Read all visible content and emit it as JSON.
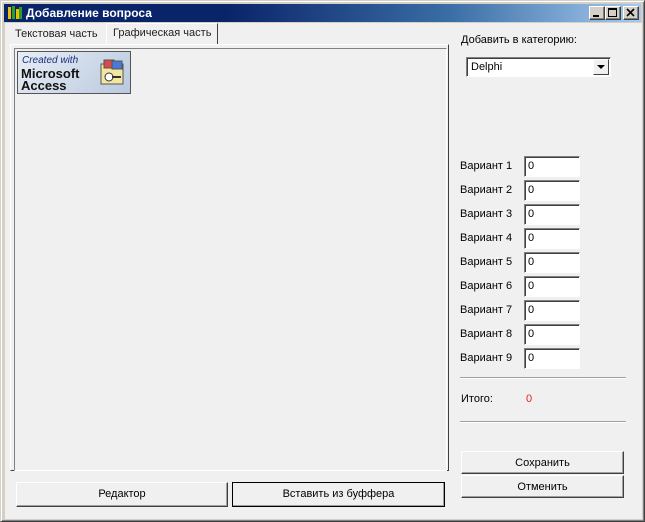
{
  "window": {
    "title": "Добавление вопроса",
    "buttons": [
      "minimize",
      "maximize",
      "close"
    ]
  },
  "tabs": [
    {
      "label": "Текстовая часть",
      "active": false
    },
    {
      "label": "Графическая часть",
      "active": true
    }
  ],
  "image_area": {
    "logo": {
      "line1": "Created with",
      "line2": "Microsoft",
      "line3": "Access"
    }
  },
  "buttons": {
    "editor": "Редактор",
    "paste": "Вставить из буффера",
    "save": "Сохранить",
    "cancel": "Отменить"
  },
  "category": {
    "label": "Добавить в категорию:",
    "value": "Delphi"
  },
  "variants": [
    {
      "label": "Вариант 1",
      "value": "0"
    },
    {
      "label": "Вариант 2",
      "value": "0"
    },
    {
      "label": "Вариант 3",
      "value": "0"
    },
    {
      "label": "Вариант 4",
      "value": "0"
    },
    {
      "label": "Вариант 5",
      "value": "0"
    },
    {
      "label": "Вариант 6",
      "value": "0"
    },
    {
      "label": "Вариант 7",
      "value": "0"
    },
    {
      "label": "Вариант 8",
      "value": "0"
    },
    {
      "label": "Вариант 9",
      "value": "0"
    }
  ],
  "total": {
    "label": "Итого:",
    "value": "0",
    "color": "#e02020"
  },
  "colors": {
    "titlebar": "#0a246a",
    "face": "#d4d0c8",
    "client": "#f0f0f0"
  }
}
